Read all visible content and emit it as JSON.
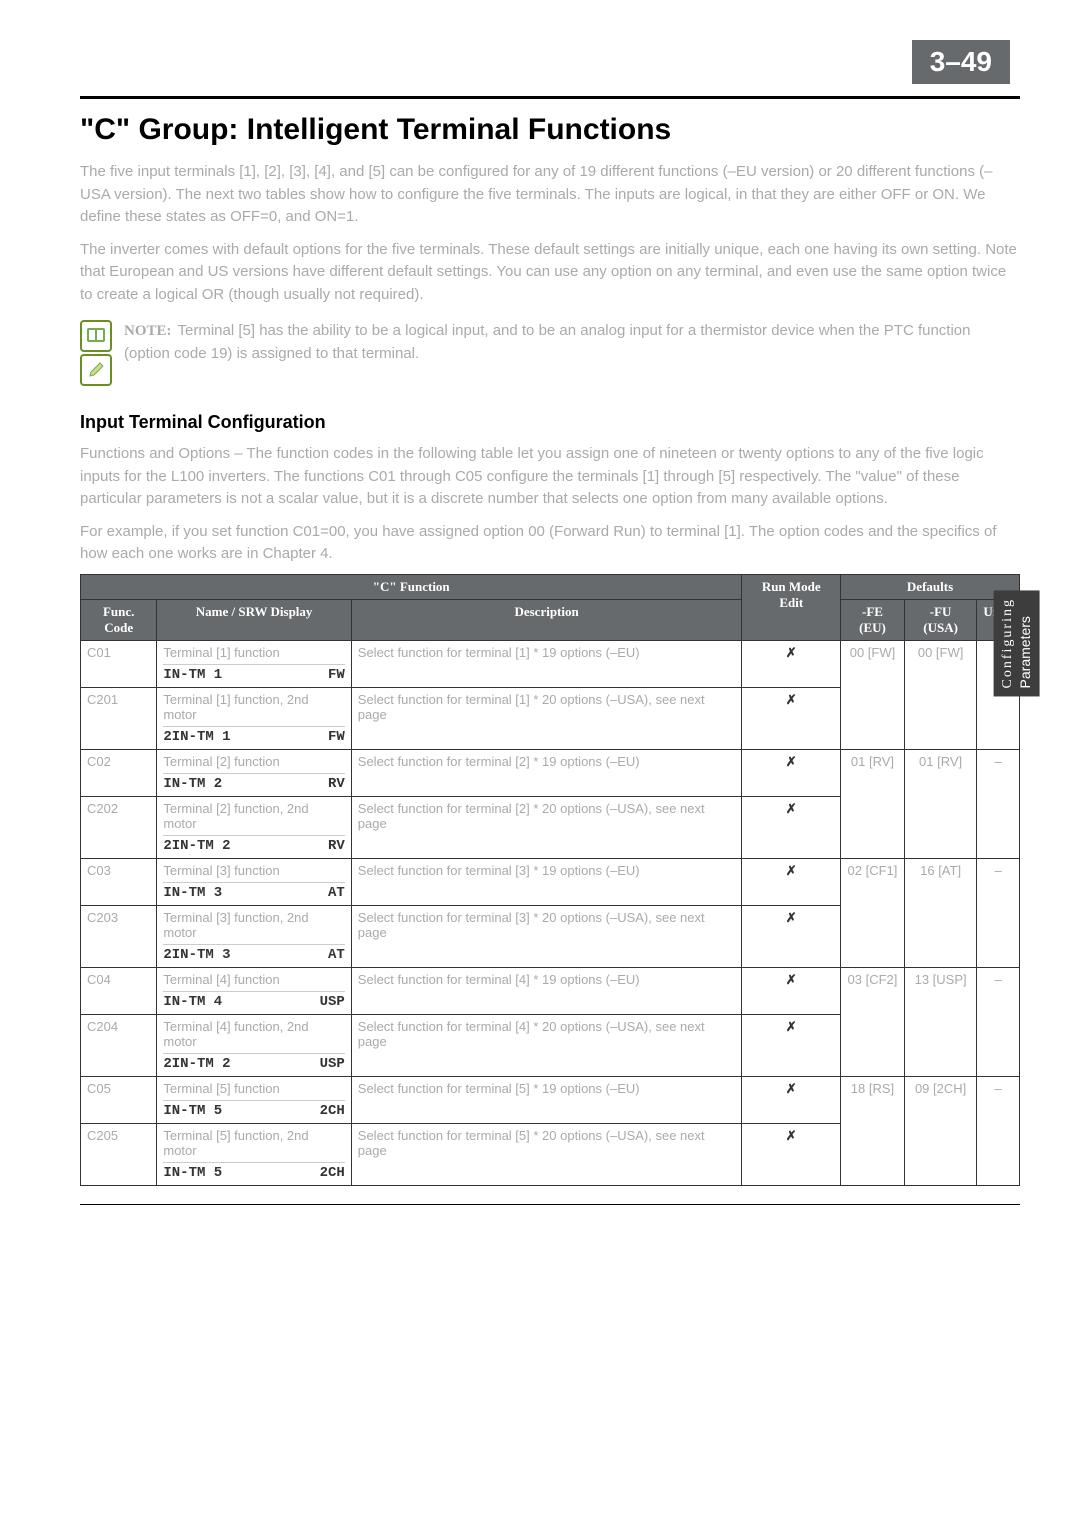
{
  "pageNumber": {
    "section": "3",
    "dash": "–",
    "page": "49"
  },
  "title": "\"C\" Group: Intelligent Terminal Functions",
  "intro1": "The five input terminals [1], [2], [3], [4], and [5] can be configured for any of 19 different functions (–EU version) or 20 different functions (–USA version). The next two tables show how to configure the five terminals. The inputs are logical, in that they are either OFF or ON. We define these states as OFF=0, and ON=1.",
  "intro2": "The inverter comes with default options for the five terminals. These default settings are initially unique, each one having its own setting. Note that European and US versions have different default settings. You can use any option on any terminal, and even use the same option twice to create a logical OR (though usually not required).",
  "note": {
    "label": "NOTE:",
    "text": "Terminal [5] has the ability to be a logical input, and to be an analog input for a thermistor device when the PTC function (option code 19) is assigned to that terminal."
  },
  "subheading": "Input Terminal Configuration",
  "para1": "Functions and Options – The function codes in the following table let you assign one of nineteen or twenty options to any of the five logic inputs for the L100 inverters. The functions C01 through C05 configure the terminals [1] through [5] respectively. The \"value\" of these particular parameters is not a scalar value, but it is a discrete number that selects one option from many available options.",
  "para2": "For example, if you set function C01=00, you have assigned option 00 (Forward Run) to terminal [1]. The option codes and the specifics of how each one works are in Chapter 4.",
  "sideTab": {
    "line1": "Configuring",
    "line2": "Parameters"
  },
  "tableHead": {
    "group": "\"C\" Function",
    "func": "Func. Code",
    "name": "Name / SRW Display",
    "desc": "Description",
    "run": "Run Mode Edit",
    "defaults": "Defaults",
    "fe": "-FE (EU)",
    "fu": "-FU (USA)",
    "units": "Units"
  },
  "rows": [
    {
      "code": "C01",
      "name": "Terminal [1] function",
      "srwL": "IN-TM 1",
      "srwR": "FW",
      "desc": "Select function for terminal [1] * 19 options (–EU)",
      "run": "✗",
      "fe": "00 [FW]",
      "fu": "00 [FW]",
      "units": "–",
      "span": 1
    },
    {
      "code": "C201",
      "name": "Terminal [1] function, 2nd motor",
      "srwL": "2IN-TM 1",
      "srwR": "FW",
      "desc": "Select function for terminal [1] * 20 options (–USA), see next page",
      "run": "✗",
      "fe": "",
      "fu": "",
      "units": "",
      "span": 1
    },
    {
      "code": "C02",
      "name": "Terminal [2] function",
      "srwL": "IN-TM 2",
      "srwR": "RV",
      "desc": "Select function for terminal [2] * 19 options (–EU)",
      "run": "✗",
      "fe": "01 [RV]",
      "fu": "01 [RV]",
      "units": "–",
      "span": 1
    },
    {
      "code": "C202",
      "name": "Terminal [2] function, 2nd motor",
      "srwL": "2IN-TM 2",
      "srwR": "RV",
      "desc": "Select function for terminal [2] * 20 options (–USA), see next page",
      "run": "✗",
      "fe": "",
      "fu": "",
      "units": "",
      "span": 1
    },
    {
      "code": "C03",
      "name": "Terminal [3] function",
      "srwL": "IN-TM 3",
      "srwR": "AT",
      "desc": "Select function for terminal [3] * 19 options (–EU)",
      "run": "✗",
      "fe": "02 [CF1]",
      "fu": "16 [AT]",
      "units": "–",
      "span": 1
    },
    {
      "code": "C203",
      "name": "Terminal [3] function, 2nd motor",
      "srwL": "2IN-TM 3",
      "srwR": "AT",
      "desc": "Select function for terminal [3] * 20 options (–USA), see next page",
      "run": "✗",
      "fe": "02 [CF1]",
      "fu": "16 [AT]",
      "units": "",
      "span": 1
    },
    {
      "code": "C04",
      "name": "Terminal [4] function",
      "srwL": "IN-TM 4",
      "srwR": "USP",
      "desc": "Select function for terminal [4] * 19 options (–EU)",
      "run": "✗",
      "fe": "03 [CF2]",
      "fu": "13 [USP]",
      "units": "–",
      "span": 1
    },
    {
      "code": "C204",
      "name": "Terminal [4] function, 2nd motor",
      "srwL": "2IN-TM 2",
      "srwR": "USP",
      "desc": "Select function for terminal [4] * 20 options (–USA), see next page",
      "run": "✗",
      "fe": "",
      "fu": "",
      "units": "",
      "span": 1
    },
    {
      "code": "C05",
      "name": "Terminal [5] function",
      "srwL": "IN-TM 5",
      "srwR": "2CH",
      "desc": "Select function for terminal [5] * 19 options (–EU)",
      "run": "✗",
      "fe": "18 [RS]",
      "fu": "09 [2CH]",
      "units": "–",
      "span": 1
    },
    {
      "code": "C205",
      "name": "Terminal [5] function, 2nd motor",
      "srwL": "IN-TM 5",
      "srwR": "2CH",
      "desc": "Select function for terminal [5] * 20 options (–USA), see next page",
      "run": "✗",
      "fe": "",
      "fu": "",
      "units": "",
      "span": 1
    }
  ]
}
